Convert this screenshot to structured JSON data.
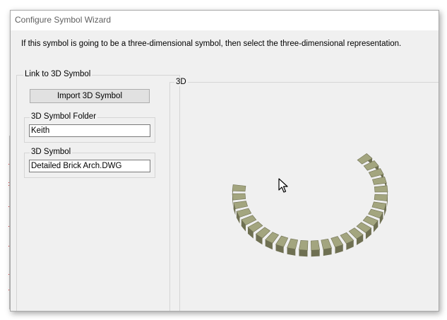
{
  "window": {
    "title": "Configure Symbol Wizard"
  },
  "intro": {
    "text": "If this symbol is going to be a three-dimensional symbol, then select the three-dimensional representation."
  },
  "link_group": {
    "label": "Link to 3D Symbol",
    "import_button_label": "Import 3D Symbol",
    "folder": {
      "label": "3D Symbol Folder",
      "value": "Keith"
    },
    "symbol": {
      "label": "3D Symbol",
      "value": "Detailed Brick Arch.DWG"
    }
  },
  "preview_group": {
    "label": "3D"
  },
  "colors": {
    "brick_top": "#a3a57f",
    "brick_side": "#6f7052",
    "dialog_bg": "#f0f0f0"
  },
  "icons": {
    "cursor": "mouse-pointer-icon"
  }
}
